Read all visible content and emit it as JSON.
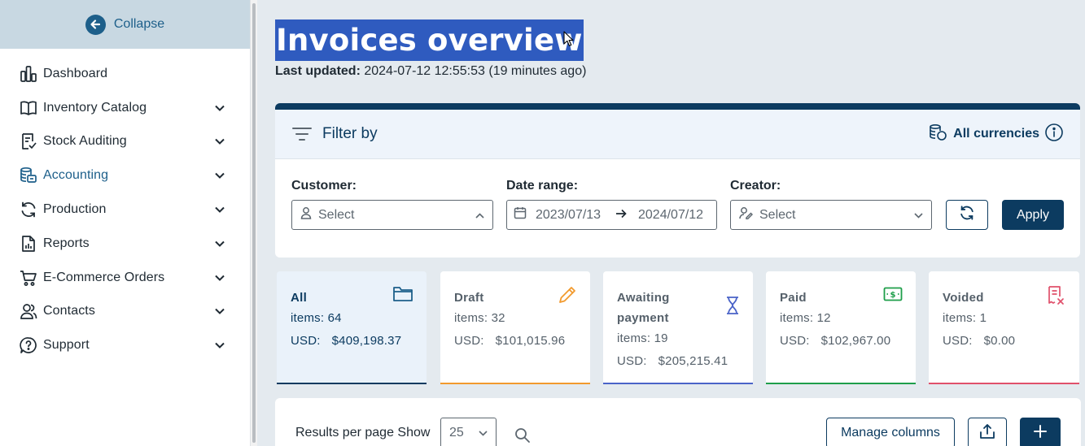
{
  "sidebar": {
    "collapse_label": "Collapse",
    "items": [
      {
        "label": "Dashboard",
        "icon": "dashboard-icon",
        "has_children": false
      },
      {
        "label": "Inventory Catalog",
        "icon": "book-icon",
        "has_children": true
      },
      {
        "label": "Stock Auditing",
        "icon": "checklist-icon",
        "has_children": true
      },
      {
        "label": "Accounting",
        "icon": "coins-icon",
        "has_children": true,
        "active": true
      },
      {
        "label": "Production",
        "icon": "refresh-icon",
        "has_children": true
      },
      {
        "label": "Reports",
        "icon": "report-icon",
        "has_children": true
      },
      {
        "label": "E-Commerce Orders",
        "icon": "cart-icon",
        "has_children": true
      },
      {
        "label": "Contacts",
        "icon": "users-icon",
        "has_children": true
      },
      {
        "label": "Support",
        "icon": "help-icon",
        "has_children": true
      }
    ]
  },
  "header": {
    "title": "Invoices overview",
    "updated_label": "Last updated:",
    "updated_value": "2024-07-12 12:55:53 (19 minutes ago)"
  },
  "filter": {
    "title": "Filter by",
    "currency_label": "All currencies",
    "customer_label": "Customer:",
    "customer_placeholder": "Select",
    "date_label": "Date range:",
    "date_from": "2023/07/13",
    "date_to": "2024/07/12",
    "creator_label": "Creator:",
    "creator_placeholder": "Select",
    "apply_label": "Apply"
  },
  "cards": [
    {
      "name": "All",
      "items": "items: 64",
      "currency": "USD:",
      "amount": "$409,198.37",
      "color": "#0c3b60",
      "icon": "folder-icon"
    },
    {
      "name": "Draft",
      "items": "items: 32",
      "currency": "USD:",
      "amount": "$101,015.96",
      "color": "#f29a2e",
      "icon": "pencil-icon"
    },
    {
      "name": "Awaiting payment",
      "items": "items: 19",
      "currency": "USD:",
      "amount": "$205,215.41",
      "color": "#4a63c8",
      "icon": "hourglass-icon"
    },
    {
      "name": "Paid",
      "items": "items: 12",
      "currency": "USD:",
      "amount": "$102,967.00",
      "color": "#1e9e4a",
      "icon": "cash-icon"
    },
    {
      "name": "Voided",
      "items": "items: 1",
      "currency": "USD:",
      "amount": "$0.00",
      "color": "#e0506b",
      "icon": "void-receipt-icon"
    }
  ],
  "results": {
    "per_page_label": "Results per page Show",
    "per_page_value": "25",
    "manage_columns_label": "Manage columns"
  },
  "colors": {
    "primary": "#0c3b60",
    "accent": "#1d5f8a",
    "title_highlight": "#2f5bbf"
  }
}
